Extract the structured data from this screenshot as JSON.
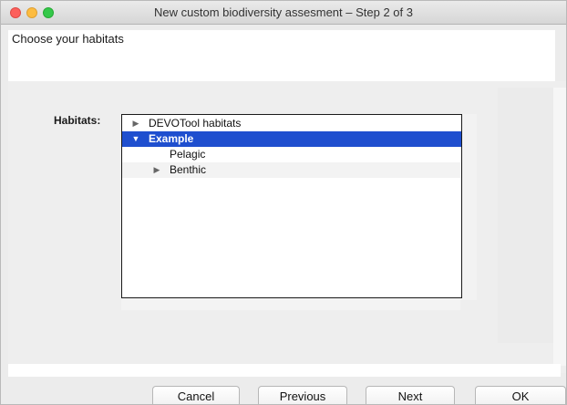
{
  "window": {
    "title": "New custom biodiversity assesment – Step 2 of 3"
  },
  "header": {
    "instruction": "Choose your habitats"
  },
  "form": {
    "habitats_label": "Habitats:"
  },
  "tree": {
    "rows": [
      {
        "label": "DEVOTool habitats",
        "expander": "collapsed",
        "selected": false
      },
      {
        "label": "Example",
        "expander": "expanded",
        "selected": true
      },
      {
        "label": "Pelagic",
        "expander": "none",
        "selected": false
      },
      {
        "label": "Benthic",
        "expander": "collapsed",
        "selected": false
      }
    ]
  },
  "buttons": {
    "cancel": "Cancel",
    "previous": "Previous",
    "next": "Next",
    "ok": "OK"
  },
  "colors": {
    "selection": "#1f4fcf",
    "close": "#fc605c",
    "minimize": "#fdbc40",
    "zoom": "#34c84a"
  }
}
